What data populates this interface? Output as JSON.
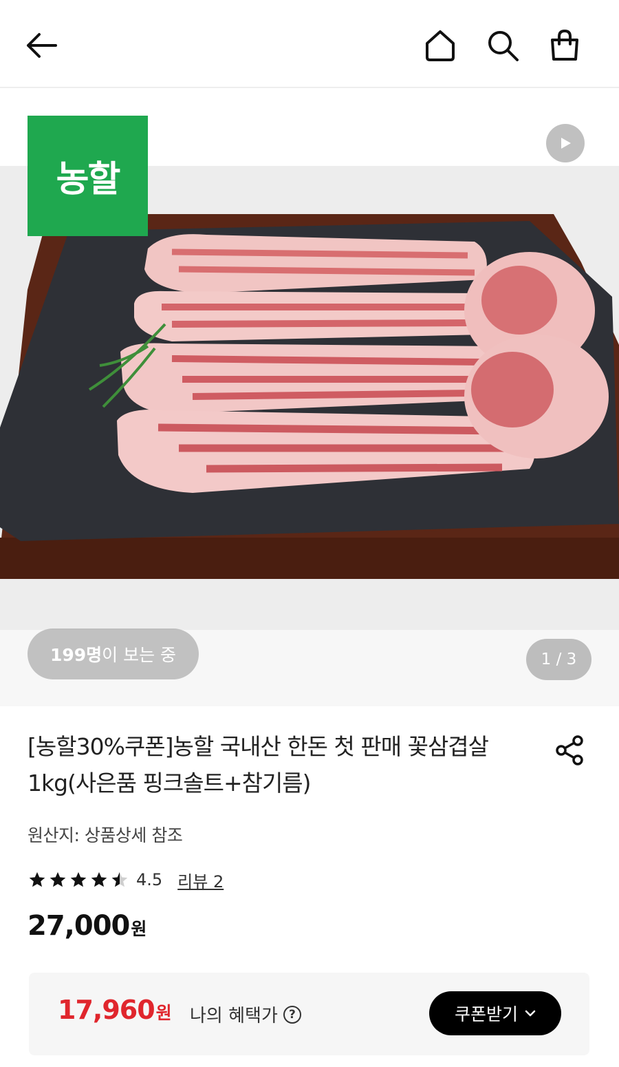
{
  "header": {
    "icons": [
      "back-arrow-icon",
      "home-icon",
      "search-icon",
      "shopping-bag-icon"
    ]
  },
  "gallery": {
    "brand_badge": "농할",
    "viewers_count": "199명",
    "viewers_suffix": "이 보는 중",
    "page_indicator": "1 / 3",
    "photo_description_icon": "play-icon"
  },
  "product": {
    "title": "[농할30%쿠폰]농할 국내산 한돈 첫 판매 꽃삼겹살1kg(사은품 핑크솔트+참기름)",
    "origin": "원산지: 상품상세 참조",
    "rating": "4.5",
    "rating_value": 4.5,
    "reviews_label": "리뷰 2",
    "price": "27,000",
    "currency": "원"
  },
  "benefit": {
    "price": "17,960",
    "currency": "원",
    "label": "나의 혜택가",
    "help_symbol": "?",
    "coupon_button": "쿠폰받기"
  },
  "colors": {
    "brand_green": "#1fa84f",
    "benefit_red": "#e0262d",
    "button_black": "#000000"
  }
}
